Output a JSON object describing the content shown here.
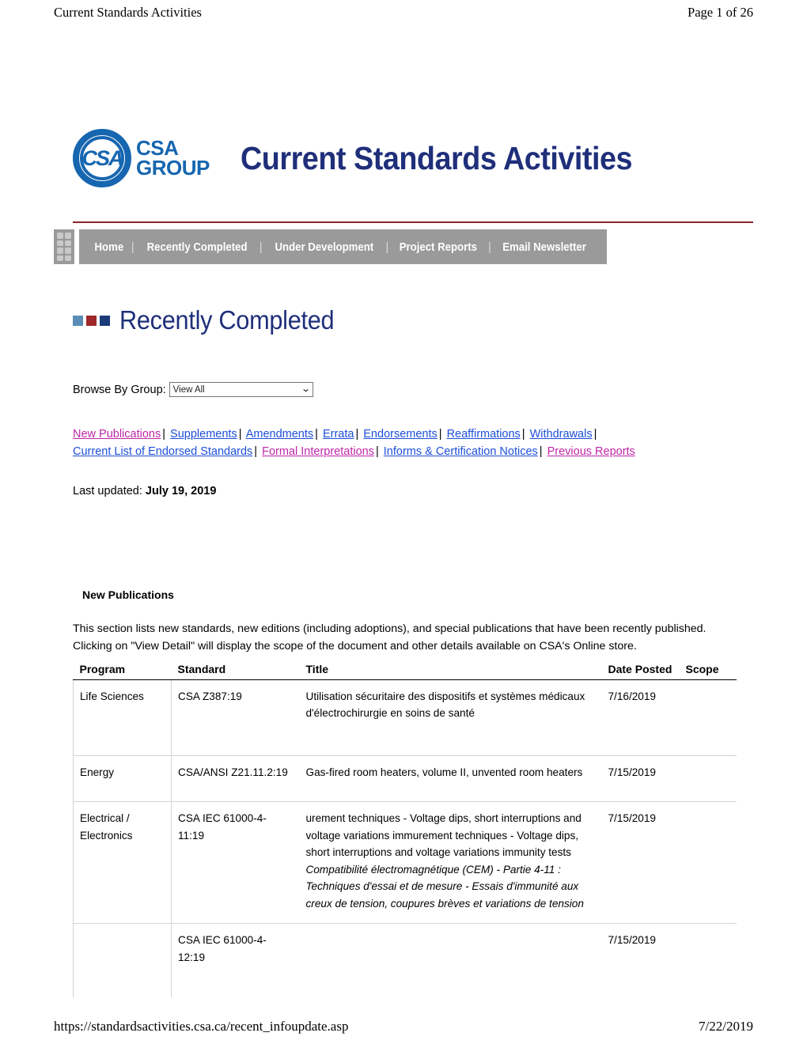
{
  "print_header": {
    "left": "Current Standards Activities",
    "right": "Page 1 of 26"
  },
  "print_footer": {
    "url": "https://standardsactivities.csa.ca/recent_infoupdate.asp",
    "date": "7/22/2019"
  },
  "masthead": {
    "logo_mark_text": "CSA",
    "logo_line1": "CSA",
    "logo_line2": "GROUP",
    "logo_tm": "®",
    "title": "Current Standards Activities"
  },
  "nav": {
    "items": [
      {
        "label": "Home"
      },
      {
        "label": "Recently Completed"
      },
      {
        "label": "Under Development"
      },
      {
        "label": "Project Reports"
      },
      {
        "label": "Email Newsletter"
      }
    ],
    "separator": "|"
  },
  "section": {
    "title": "Recently Completed",
    "square_colors": [
      "#5b8cb8",
      "#a02828",
      "#1b3a7a"
    ]
  },
  "browse": {
    "label": "Browse By Group:",
    "selected": "View All",
    "caret": "⌄"
  },
  "links": {
    "separator": "|",
    "items": [
      {
        "label": "New Publications",
        "state": "visited"
      },
      {
        "label": "Supplements",
        "state": "unvisited"
      },
      {
        "label": "Amendments",
        "state": "unvisited"
      },
      {
        "label": "Errata",
        "state": "unvisited"
      },
      {
        "label": "Endorsements",
        "state": "unvisited"
      },
      {
        "label": "Reaffirmations",
        "state": "unvisited"
      },
      {
        "label": "Withdrawals",
        "state": "unvisited"
      },
      {
        "label": "Current List of Endorsed Standards",
        "state": "unvisited"
      },
      {
        "label": "Formal Interpretations",
        "state": "visited"
      },
      {
        "label": "Informs & Certification Notices",
        "state": "unvisited"
      },
      {
        "label": "Previous Reports",
        "state": "visited"
      }
    ]
  },
  "last_updated": {
    "label": "Last updated:",
    "value": "July 19, 2019"
  },
  "new_publications": {
    "heading": "New Publications",
    "description": "This section lists new standards, new editions (including adoptions), and special publications that have been recently published. Clicking on \"View Detail\" will display the scope of the document and other details available on CSA's Online store.",
    "columns": [
      "Program",
      "Standard",
      "Title",
      "Date Posted",
      "Scope"
    ],
    "rows": [
      {
        "program": "Life Sciences",
        "standard": "CSA Z387:19",
        "title_en": "Utilisation sécuritaire des dispositifs et systèmes médicaux d'électrochirurgie en soins de santé",
        "title_fr": "",
        "date_posted": "7/16/2019",
        "scope": ""
      },
      {
        "program": "Energy",
        "standard": "CSA/ANSI Z21.11.2:19",
        "title_en": "Gas-fired room heaters, volume II, unvented room heaters",
        "title_fr": "",
        "date_posted": "7/15/2019",
        "scope": ""
      },
      {
        "program": "Electrical / Electronics",
        "standard": "CSA IEC 61000-4-11:19",
        "title_en": "urement techniques - Voltage dips, short interruptions and voltage variations immurement techniques - Voltage dips, short interruptions and voltage variations immunity tests",
        "title_fr": "Compatibilité électromagnétique (CEM) - Partie 4-11 : Techniques d'essai et de mesure - Essais d'immunité aux creux de tension, coupures brèves et variations de tension",
        "date_posted": "7/15/2019",
        "scope": ""
      },
      {
        "program": "",
        "standard": "CSA IEC 61000-4-12:19",
        "title_en": "",
        "title_fr": "",
        "date_posted": "7/15/2019",
        "scope": ""
      }
    ]
  }
}
